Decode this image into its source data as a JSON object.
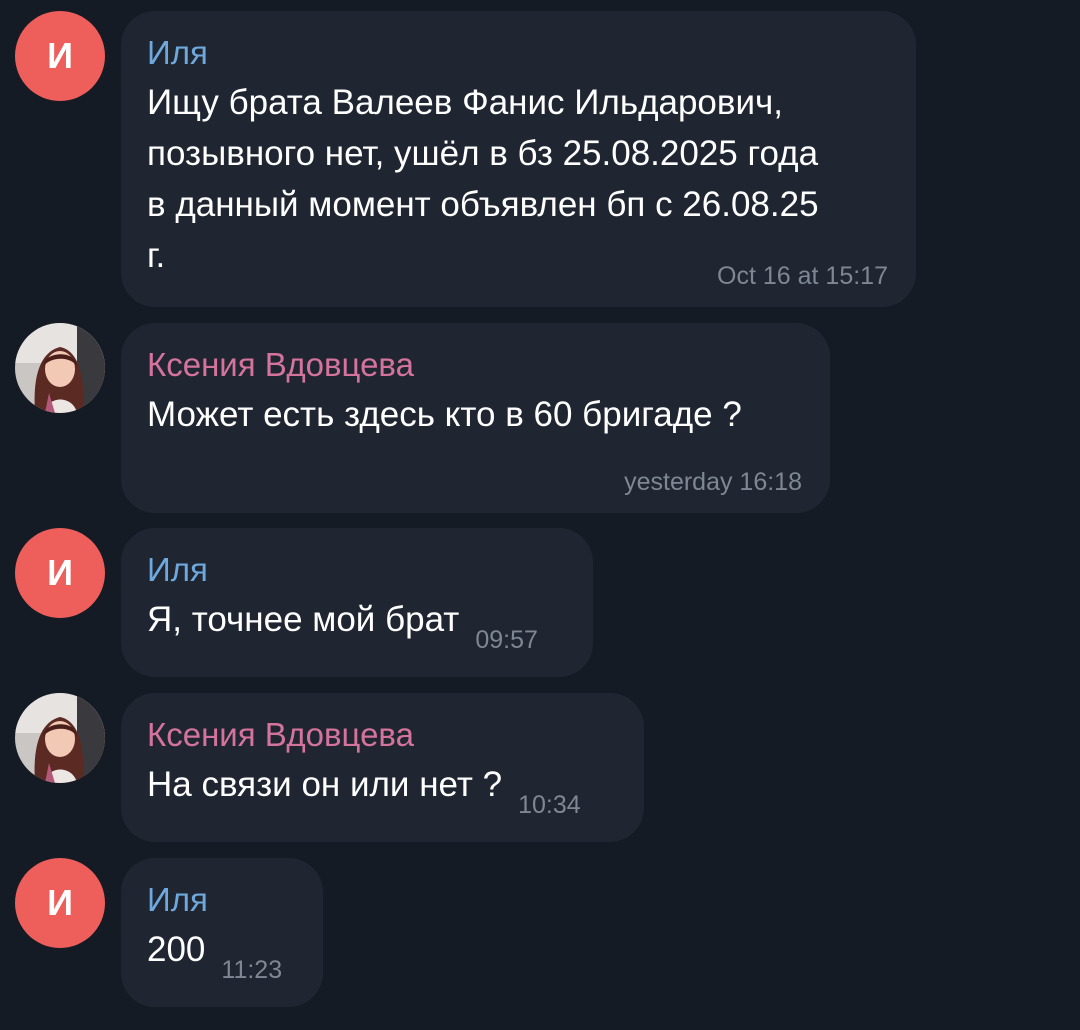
{
  "users": {
    "ilya": {
      "name": "Иля",
      "initial": "И",
      "avatar_color": "#ee5e5a",
      "name_color": "#6fa8dc"
    },
    "ksenia": {
      "name": "Ксения Вдовцева",
      "name_color": "#d4739b"
    }
  },
  "messages": [
    {
      "sender": "Иля",
      "lines": [
        "Ищу брата Валеев Фанис Ильдарович,",
        "позывного нет, ушёл в бз 25.08.2025 года",
        "в данный момент объявлен бп с 26.08.25",
        "г."
      ],
      "time": "Oct 16 at 15:17"
    },
    {
      "sender": "Ксения Вдовцева",
      "lines": [
        "Может есть здесь  кто в 60 бригаде ?"
      ],
      "time": "yesterday 16:18"
    },
    {
      "sender": "Иля",
      "lines": [
        "Я, точнее мой брат"
      ],
      "time": "09:57"
    },
    {
      "sender": "Ксения Вдовцева",
      "lines": [
        "На связи он или нет ?"
      ],
      "time": "10:34"
    },
    {
      "sender": "Иля",
      "lines": [
        "200"
      ],
      "time": "11:23"
    }
  ]
}
